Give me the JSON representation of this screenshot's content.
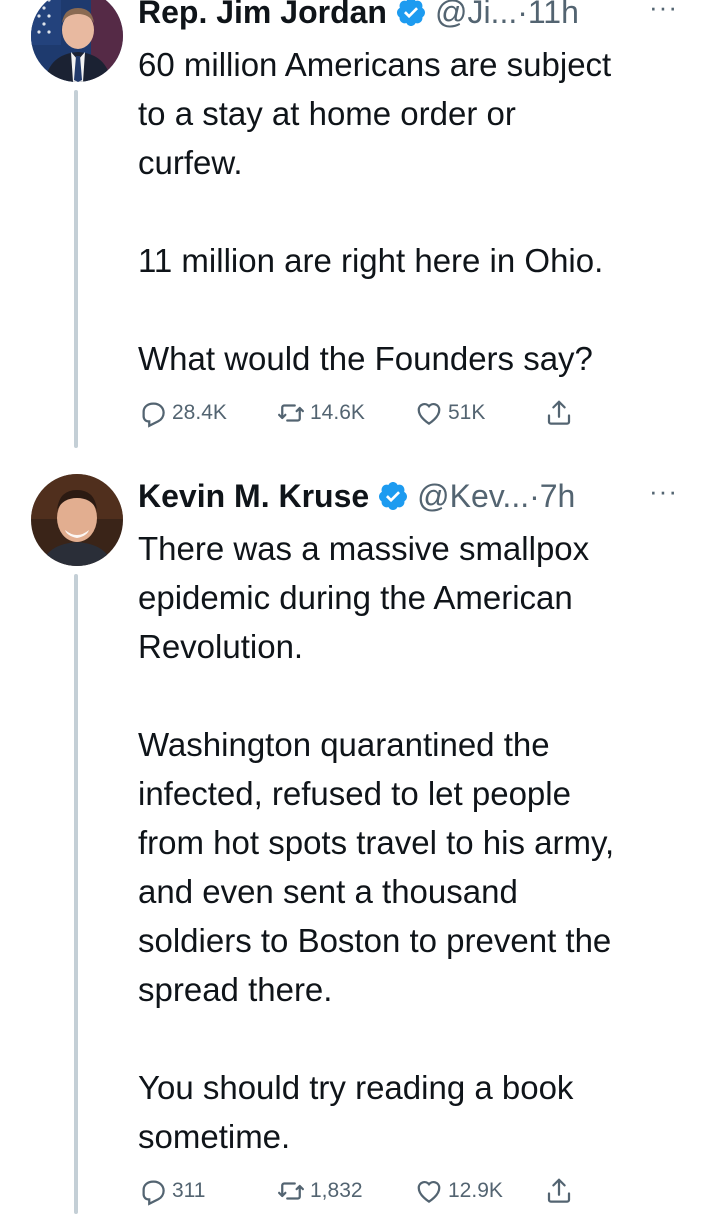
{
  "tweets": [
    {
      "name": "Rep. Jim Jordan",
      "handle": "@Ji...",
      "dot": "·",
      "time": "11h",
      "more": "···",
      "text": "60 million Americans are subject\nto a stay at home order or\ncurfew.\n\n11 million are right here in Ohio.\n\nWhat would the Founders say?",
      "replies": "28.4K",
      "retweets": "14.6K",
      "likes": "51K"
    },
    {
      "name": "Kevin M. Kruse",
      "handle": "@Kev...",
      "dot": "·",
      "time": "7h",
      "more": "···",
      "text": "There was a massive smallpox\nepidemic during the American\nRevolution.\n\nWashington quarantined the\ninfected, refused to let people\nfrom hot spots travel to his army,\nand even sent a thousand\nsoldiers to Boston to prevent the\nspread there.\n\nYou should try reading a book\nsometime.",
      "replies": "311",
      "retweets": "1,832",
      "likes": "12.9K"
    }
  ],
  "colors": {
    "verified": "#1d9bf0",
    "secondary": "#536471",
    "thread_line": "#c4cfd6"
  },
  "icons": [
    "verified-badge-icon",
    "reply-icon",
    "retweet-icon",
    "like-icon",
    "share-icon",
    "more-icon"
  ]
}
